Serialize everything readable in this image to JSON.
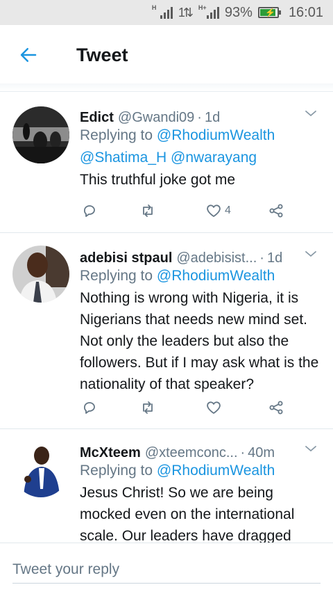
{
  "status_bar": {
    "network_1": "H",
    "network_2": "H+",
    "battery_percent": "93%",
    "battery_level": 0.93,
    "time": "16:01"
  },
  "header": {
    "title": "Tweet",
    "back_icon": "arrow-left-icon"
  },
  "tweets": [
    {
      "name": "Edict",
      "handle": "@Gwandi09",
      "time": "1d",
      "replying_label": "Replying to",
      "replying_to": [
        "@RhodiumWealth",
        "@Shatima_H",
        "@nwarayang"
      ],
      "text": "This truthful joke got me",
      "likes": "4"
    },
    {
      "name": "adebisi stpaul",
      "handle": "@adebisist...",
      "time": "1d",
      "replying_label": "Replying to",
      "replying_to": [
        "@RhodiumWealth"
      ],
      "text": "Nothing is wrong with Nigeria, it is Nigerians that needs new mind set. Not only the leaders but also the followers. But if I may ask what is the nationality of that speaker?",
      "likes": ""
    },
    {
      "name": "McXteem",
      "handle": "@xteemconc...",
      "time": "40m",
      "replying_label": "Replying to",
      "replying_to": [
        "@RhodiumWealth"
      ],
      "text": "Jesus Christ! So we are being mocked even on the international scale. Our leaders have dragged",
      "likes": ""
    }
  ],
  "reply_bar": {
    "placeholder": "Tweet your reply"
  },
  "colors": {
    "accent": "#1b95e0",
    "secondary_text": "#657786",
    "primary_text": "#14171a"
  }
}
